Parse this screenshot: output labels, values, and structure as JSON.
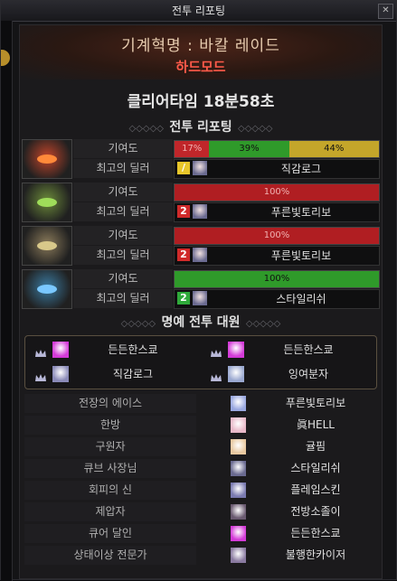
{
  "window": {
    "title": "전투 리포팅"
  },
  "header": {
    "raid_name": "기계혁명 : 바칼 레이드",
    "mode": "하드모드"
  },
  "clear_time": "클리어타임  18분58초",
  "section_report": "전투 리포팅",
  "section_members": "명예 전투 대원",
  "labels": {
    "contribution": "기여도",
    "top_dealer": "최고의 딜러"
  },
  "parties": [
    {
      "face_color": "#c0442a",
      "eye_color": "#ff8a3a",
      "segments": [
        {
          "label": "17%",
          "value": 17,
          "color": "#c0262a"
        },
        {
          "label": "39%",
          "value": 39,
          "color": "#2f9a2a"
        },
        {
          "label": "44%",
          "value": 44,
          "color": "#c4a62a"
        }
      ],
      "job_badge": "/",
      "job_color": "#e8c62a",
      "dealer": "직감로그"
    },
    {
      "face_color": "#6c8a3a",
      "eye_color": "#9fdc5a",
      "segments": [
        {
          "label": "100%",
          "value": 100,
          "color": "#b01e22"
        }
      ],
      "job_badge": "2",
      "job_color": "#d02a2a",
      "dealer": "푸른빛토리보"
    },
    {
      "face_color": "#8a7a5a",
      "eye_color": "#d8c88a",
      "segments": [
        {
          "label": "100%",
          "value": 100,
          "color": "#b01e22"
        }
      ],
      "job_badge": "2",
      "job_color": "#d02a2a",
      "dealer": "푸른빛토리보"
    },
    {
      "face_color": "#3a7aa0",
      "eye_color": "#7ac8ff",
      "segments": [
        {
          "label": "100%",
          "value": 100,
          "color": "#2f9a2a"
        }
      ],
      "job_badge": "2",
      "job_color": "#2faa3a",
      "dealer": "스타일리쉬"
    }
  ],
  "members": [
    {
      "name": "든든한스쿄",
      "avatar_color": "#d43ad8"
    },
    {
      "name": "든든한스쿄",
      "avatar_color": "#d43ad8"
    },
    {
      "name": "직감로그",
      "avatar_color": "#8a8ab8"
    },
    {
      "name": "잉여분자",
      "avatar_color": "#9aa8d0"
    }
  ],
  "awards": [
    {
      "title": "전장의 에이스",
      "name": "푸른빛토리보",
      "avatar_color": "#9aa8e0"
    },
    {
      "title": "한방",
      "name": "眞HELL",
      "avatar_color": "#e8b8c8"
    },
    {
      "title": "구원자",
      "name": "귤핌",
      "avatar_color": "#e8c8a0"
    },
    {
      "title": "큐브 사장님",
      "name": "스타일리쉬",
      "avatar_color": "#6a6a90"
    },
    {
      "title": "회피의 신",
      "name": "플레임스킨",
      "avatar_color": "#7a7ab0"
    },
    {
      "title": "제압자",
      "name": "전방소졸이",
      "avatar_color": "#6a5a70"
    },
    {
      "title": "큐어 달인",
      "name": "든든한스쿄",
      "avatar_color": "#d43ad8"
    },
    {
      "title": "상태이상 전문가",
      "name": "불행한카이저",
      "avatar_color": "#8a7aa0"
    }
  ]
}
